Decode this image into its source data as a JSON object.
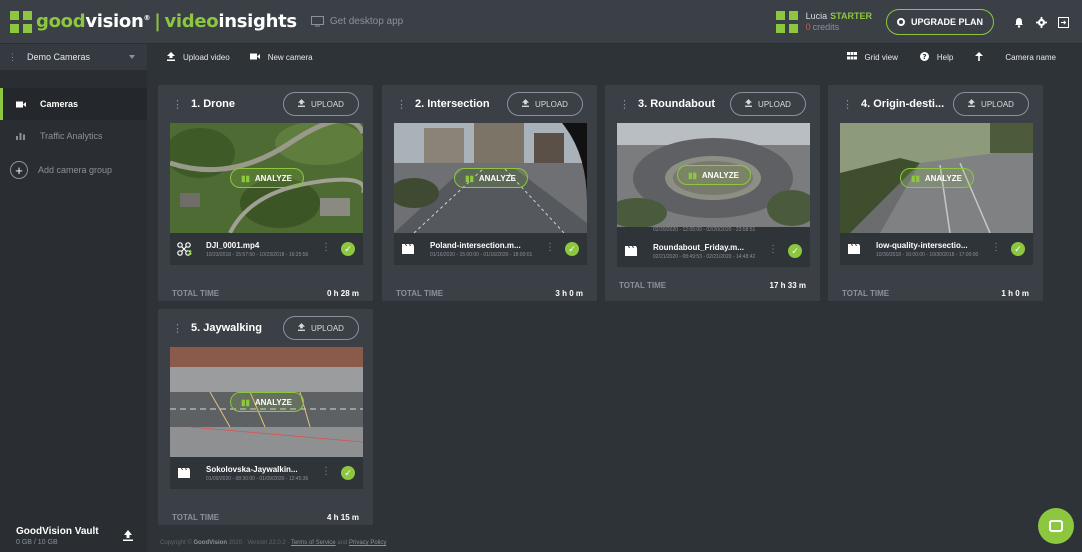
{
  "header": {
    "logo": {
      "good": "good",
      "vision": "vision",
      "reg": "®",
      "sep": "|",
      "video": "video",
      "insights": "insights"
    },
    "desktop_app": "Get desktop app",
    "user": {
      "name": "Lucia",
      "plan": "STARTER",
      "credits_value": "0",
      "credits_label": "credits"
    },
    "upgrade_label": "UPGRADE PLAN"
  },
  "sidebar": {
    "group_name": "Demo Cameras",
    "items": [
      {
        "label": "Cameras",
        "icon": "camera-icon",
        "active": true
      },
      {
        "label": "Traffic Analytics",
        "icon": "chart-icon",
        "active": false
      }
    ],
    "add_group": "Add camera group",
    "vault": {
      "title": "GoodVision Vault",
      "size": "0 GB / 10 GB"
    }
  },
  "toolbar": {
    "upload_video": "Upload video",
    "new_camera": "New camera",
    "grid_view": "Grid view",
    "help": "Help",
    "sort": "Camera name"
  },
  "cards": [
    {
      "title": "1. Drone",
      "upload": "UPLOAD",
      "analyze": "ANALYZE",
      "file_name": "DJI_0001.mp4",
      "file_date": "10/23/2018 - 15:57:50 - 10/23/2018 - 16:25:56",
      "file_icon": "drone-icon",
      "badge": "3",
      "total_label": "TOTAL TIME",
      "total_value": "0 h 28 m"
    },
    {
      "title": "2. Intersection",
      "upload": "UPLOAD",
      "analyze": "ANALYZE",
      "file_name": "Poland-intersection.m...",
      "file_date": "01/16/2020 - 15:00:00 - 01/16/2020 - 18:00:01",
      "file_icon": "film-icon",
      "badge": "",
      "total_label": "TOTAL TIME",
      "total_value": "3 h 0 m"
    },
    {
      "title": "3. Roundabout",
      "upload": "UPLOAD",
      "analyze": "ANALYZE",
      "file_name": "Roundabout_Friday.m...",
      "file_date": "02/21/2020 - 08:49:53 - 02/21/2020 - 14:48:42",
      "file_icon": "film-icon",
      "badge": "",
      "prev_date": "02/20/2020 - 12:05:00 - 02/20/2020 - 23:58:51",
      "total_label": "TOTAL TIME",
      "total_value": "17 h 33 m"
    },
    {
      "title": "4. Origin-desti...",
      "upload": "UPLOAD",
      "analyze": "ANALYZE",
      "file_name": "low-quality-intersectio...",
      "file_date": "10/30/2018 - 16:00:00 - 10/30/2018 - 17:00:00",
      "file_icon": "film-icon",
      "badge": "",
      "total_label": "TOTAL TIME",
      "total_value": "1 h 0 m"
    },
    {
      "title": "5. Jaywalking",
      "upload": "UPLOAD",
      "analyze": "ANALYZE",
      "file_name": "Sokolovska-Jaywalkin...",
      "file_date": "01/09/2020 - 08:30:00 - 01/09/2020 - 12:45:36",
      "file_icon": "film-icon",
      "badge": "",
      "total_label": "TOTAL TIME",
      "total_value": "4 h 15 m"
    }
  ],
  "footer": {
    "copyright": "Copyright ©",
    "brand": "GoodVision",
    "year_version": "2020 · Version 22.0.2 ·",
    "tos": "Terms of Service",
    "and": "and",
    "privacy": "Privacy Policy"
  },
  "colors": {
    "accent": "#8dc63f",
    "background": "#2e3338",
    "card": "#3a4046",
    "sidebar": "#2a2e33"
  }
}
